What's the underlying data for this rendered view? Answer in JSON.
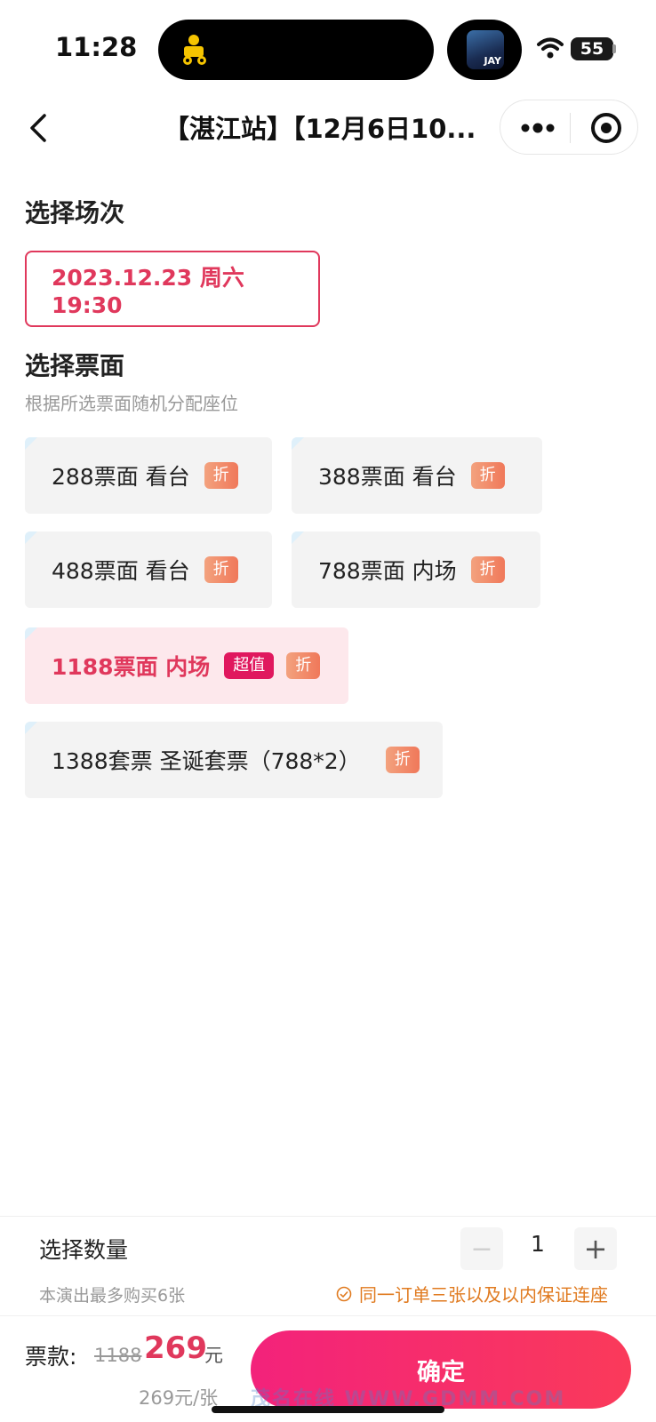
{
  "status_bar": {
    "time": "11:28",
    "battery": "55",
    "thumb_text": "JAY"
  },
  "nav": {
    "title": "【湛江站】【12月6日10..."
  },
  "session": {
    "heading": "选择场次",
    "selected": "2023.12.23 周六 19:30"
  },
  "tickets": {
    "heading": "选择票面",
    "hint": "根据所选票面随机分配座位",
    "items": [
      {
        "label": "288票面 看台",
        "badge": "折"
      },
      {
        "label": "388票面 看台",
        "badge": "折"
      },
      {
        "label": "488票面 看台",
        "badge": "折"
      },
      {
        "label": "788票面 内场",
        "badge": "折"
      },
      {
        "label": "1188票面 内场",
        "badge_value": "超值",
        "badge": "折",
        "selected": true
      },
      {
        "label": "1388套票 圣诞套票（788*2）",
        "badge": "折"
      }
    ]
  },
  "quantity": {
    "title": "选择数量",
    "limit_note": "本演出最多购买6张",
    "minus": "−",
    "value": "1",
    "plus": "+",
    "seat_note": "同一订单三张以及以内保证连座"
  },
  "payment": {
    "label": "票款:",
    "original_price": "1188",
    "price": "269",
    "unit": "元",
    "per_ticket": "269元/张",
    "confirm": "确定"
  },
  "watermark": "茂名在线 WWW.GDMM.COM",
  "colors": {
    "accent": "#e0385c",
    "selected_bg": "#fde8ec",
    "orange_note": "#e07a1f",
    "confirm_start": "#f3227b",
    "confirm_end": "#fa3a5a"
  }
}
